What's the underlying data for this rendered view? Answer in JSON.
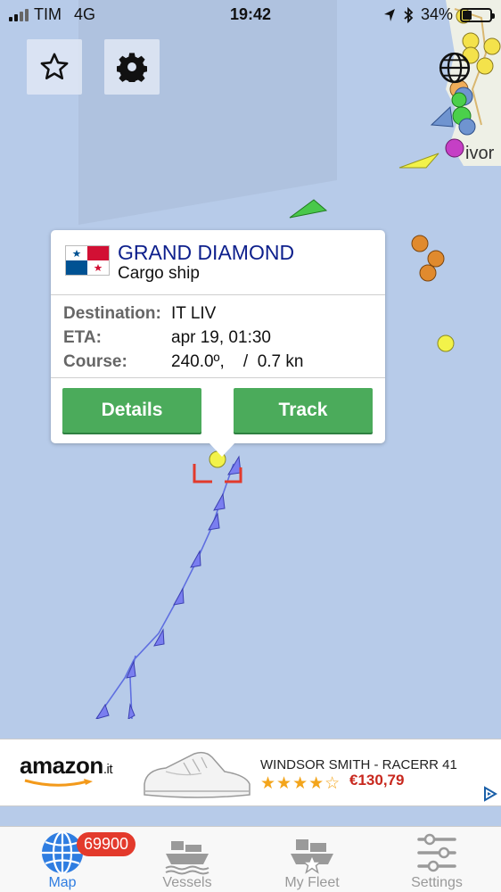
{
  "status": {
    "carrier": "TIM",
    "network": "4G",
    "time": "19:42",
    "battery": "34%",
    "battery_level": 0.34
  },
  "map": {
    "city_label": "ivor"
  },
  "popup": {
    "name": "GRAND DIAMOND",
    "type": "Cargo ship",
    "rows": [
      {
        "label": "Destination:",
        "value": "IT LIV"
      },
      {
        "label": "ETA:",
        "value": "apr 19, 01:30"
      },
      {
        "label": "Course:",
        "value": "240.0º,    /  0.7 kn"
      }
    ],
    "details_label": "Details",
    "track_label": "Track"
  },
  "ad": {
    "brand": "amazon",
    "brand_suffix": ".it",
    "title": "WINDSOR SMITH - RACERR 41",
    "rating": 4,
    "stars": "★★★★☆",
    "price": "€130,79"
  },
  "tabs": [
    {
      "label": "Map",
      "badge": "69900",
      "active": true
    },
    {
      "label": "Vessels"
    },
    {
      "label": "My Fleet"
    },
    {
      "label": "Settings"
    }
  ],
  "colors": {
    "active_tab": "#2f7de1",
    "inactive_tab": "#9a9a9a",
    "button_green": "#4bab5b",
    "ship_name": "#0d1f8c",
    "badge": "#e33a2c"
  }
}
